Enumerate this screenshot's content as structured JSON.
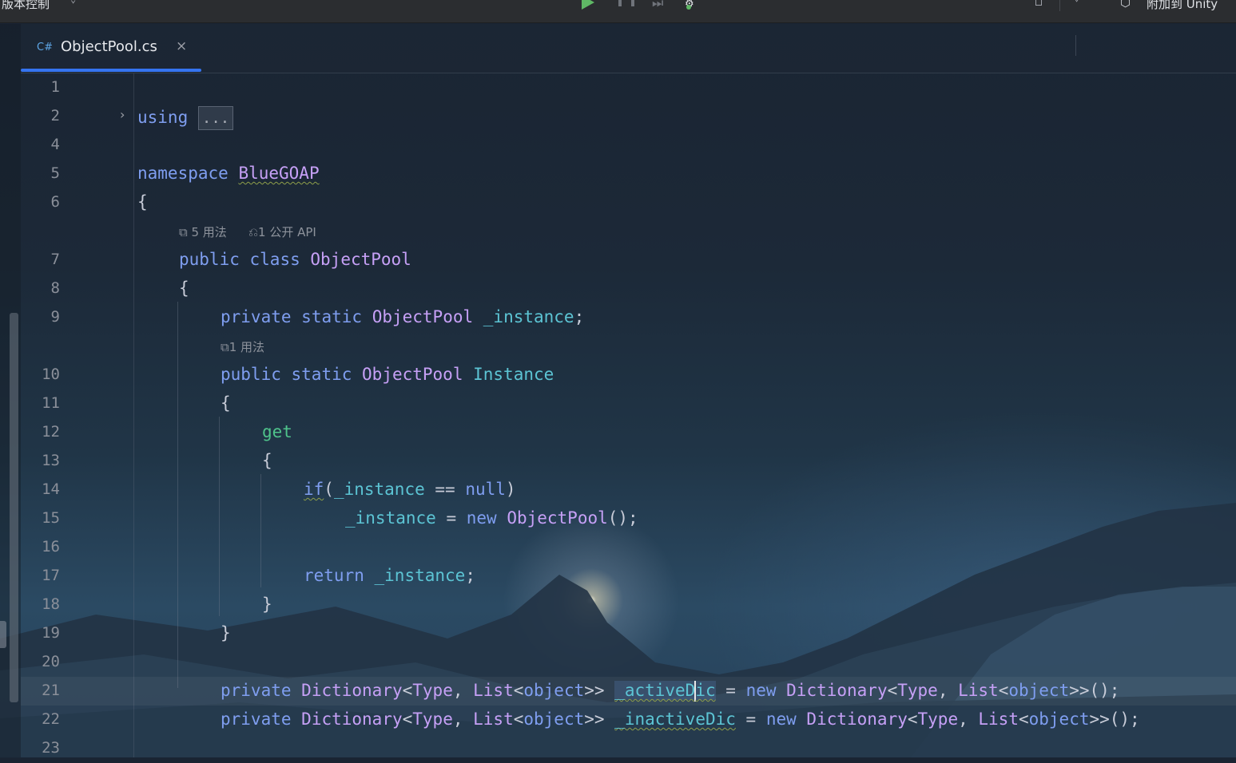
{
  "topbar": {
    "vcs_label": "版本控制",
    "attach_label": "附加到 Unity"
  },
  "tab": {
    "lang": "C#",
    "file_name": "ObjectPool.cs",
    "close": "×"
  },
  "hints": {
    "class_usages": "5 用法",
    "class_api": "1 公开 API",
    "prop_usages": "1 用法"
  },
  "lines": [
    {
      "n": "1"
    },
    {
      "n": "2",
      "tokens": [
        "using",
        "..."
      ]
    },
    {
      "n": "4"
    },
    {
      "n": "5",
      "tokens": [
        "namespace",
        "BlueGOAP"
      ]
    },
    {
      "n": "6",
      "tokens": [
        "{"
      ]
    },
    {
      "n": "7",
      "tokens": [
        "public",
        "class",
        "ObjectPool"
      ]
    },
    {
      "n": "8",
      "tokens": [
        "{"
      ]
    },
    {
      "n": "9",
      "tokens": [
        "private",
        "static",
        "ObjectPool",
        "_instance",
        ";"
      ]
    },
    {
      "n": "10",
      "tokens": [
        "public",
        "static",
        "ObjectPool",
        "Instance"
      ]
    },
    {
      "n": "11",
      "tokens": [
        "{"
      ]
    },
    {
      "n": "12",
      "tokens": [
        "get"
      ]
    },
    {
      "n": "13",
      "tokens": [
        "{"
      ]
    },
    {
      "n": "14",
      "tokens": [
        "if",
        "(",
        "_instance",
        " == ",
        "null",
        ")"
      ]
    },
    {
      "n": "15",
      "tokens": [
        "_instance",
        " = ",
        "new",
        "ObjectPool",
        "();"
      ]
    },
    {
      "n": "16"
    },
    {
      "n": "17",
      "tokens": [
        "return",
        "_instance",
        ";"
      ]
    },
    {
      "n": "18",
      "tokens": [
        "}"
      ]
    },
    {
      "n": "19",
      "tokens": [
        "}"
      ]
    },
    {
      "n": "20"
    },
    {
      "n": "21",
      "tokens": [
        "private",
        "Dictionary",
        "<",
        "Type",
        ", ",
        "List",
        "<",
        "object",
        ">> ",
        "_activeD",
        "ic",
        " = ",
        "new",
        "Dictionary",
        "<",
        "Type",
        ", ",
        "List",
        "<",
        "object",
        ">>();"
      ]
    },
    {
      "n": "22",
      "tokens": [
        "private",
        "Dictionary",
        "<",
        "Type",
        ", ",
        "List",
        "<",
        "object",
        ">> ",
        "_inactiveDic",
        " = ",
        "new",
        "Dictionary",
        "<",
        "Type",
        ", ",
        "List",
        "<",
        "object",
        ">>();"
      ]
    },
    {
      "n": "23"
    }
  ]
}
